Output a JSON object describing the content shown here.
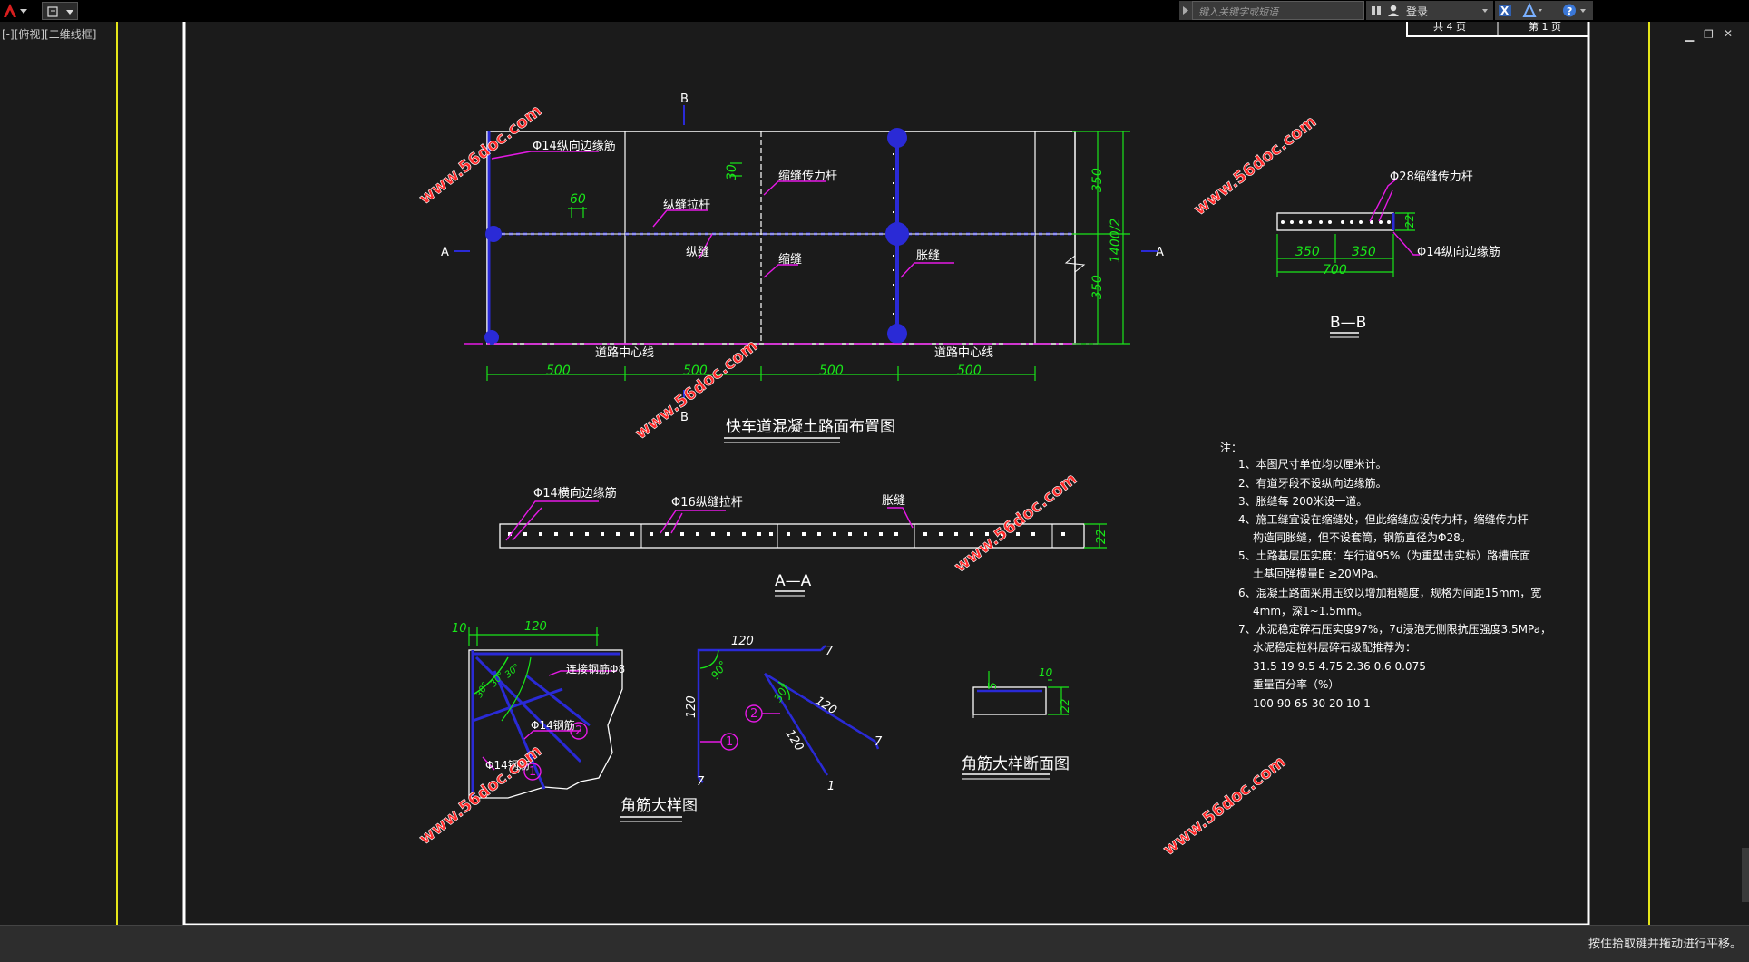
{
  "window": {
    "viewport_label": "[-][俯视][二维线框]",
    "search_placeholder": "键入关键字或短语",
    "login_label": "登录",
    "status_message": "按住拾取键并拖动进行平移。"
  },
  "sheet": {
    "header_sheet_total": "共 4 页",
    "header_sheet_no": "第 1 页"
  },
  "plan": {
    "title": "快车道混凝土路面布置图",
    "labels": {
      "long_edge_bar": "Φ14纵向边缘筋",
      "long_joint_tie": "纵缝拉杆",
      "contraction_dowel": "缩缝传力杆",
      "long_joint": "纵缝",
      "contraction_joint": "缩缝",
      "expansion_joint": "胀缝",
      "centerline_left": "道路中心线",
      "centerline_right": "道路中心线",
      "section_B_top": "B",
      "section_B_bottom": "B",
      "section_A_left": "A",
      "section_A_right": "A"
    },
    "dims": {
      "d60": "60",
      "d30": "30",
      "d500_1": "500",
      "d500_2": "500",
      "d500_3": "500",
      "d500_4": "500",
      "d350_top": "350",
      "d350_bot": "350",
      "d1400": "1400/2"
    }
  },
  "section_aa": {
    "title": "A—A",
    "label_edge": "Φ14横向边缘筋",
    "label_tie": "Φ16纵缝拉杆",
    "label_exp": "胀缝",
    "dim": "22"
  },
  "section_bb": {
    "title": "B—B",
    "label_dowel": "Φ28缩缝传力杆",
    "label_edge": "Φ14纵向边缘筋",
    "d350a": "350",
    "d350b": "350",
    "d700": "700",
    "d22": "22"
  },
  "corner_detail": {
    "title": "角筋大样图",
    "d10": "10",
    "d120": "120",
    "label_connect": "连接钢筋Φ8",
    "label_bar1": "Φ14钢筋",
    "label_bar2": "Φ14钢筋",
    "a30a": "30°",
    "a30b": "30°",
    "a30c": "30°",
    "n1": "1",
    "n2": "2"
  },
  "bar_shapes": {
    "d120_top": "120",
    "d7_top": "7",
    "d120_left": "120",
    "d7_bot": "7",
    "a90": "90°",
    "a30": "30°",
    "d120_diag": "120",
    "d7_diag": "7",
    "d120_diag2": "120",
    "d1_diag2": "1",
    "n1": "1",
    "n2": "2"
  },
  "corner_section": {
    "title": "角筋大样断面图",
    "d5": "5",
    "d10": "10",
    "d22": "22"
  },
  "notes": {
    "heading": "注：",
    "lines": [
      "1、本图尺寸单位均以厘米计。",
      "2、有道牙段不设纵向边缘筋。",
      "3、胀缝每 200米设一道。",
      "4、施工缝宜设在缩缝处，但此缩缝应设传力杆，缩缝传力杆",
      "构造同胀缝，但不设套筒，钢筋直径为Φ28。",
      "5、土路基层压实度：车行道95%（为重型击实标）路槽底面",
      "土基回弹模量E ≥20MPa。",
      "6、混凝土路面采用压纹以增加粗糙度，规格为间距15mm，宽",
      "4mm，深1~1.5mm。",
      "7、水泥稳定碎石压实度97%，7d浸泡无侧限抗压强度3.5MPa，",
      "水泥稳定粒料层碎石级配推荐为：",
      "31.5   19   9.5   4.75   2.36   0.6   0.075",
      "重量百分率（%）",
      "100    90   65     30     20     10     1"
    ]
  },
  "watermarks": {
    "w1": "www.56doc.com",
    "w2": "www.56doc.com",
    "w3": "www.56doc.com",
    "w4": "www.56doc.com",
    "w5": "www.56doc.com",
    "w6": "www.56doc.com"
  },
  "colors": {
    "bg": "#1b1b1b",
    "white_line": "#ffffff",
    "blue_line": "#2a2ad6",
    "green_dim": "#19e619",
    "magenta": "#e619e6",
    "yellow": "#e6e619",
    "watermark": "#ff2a2a"
  }
}
